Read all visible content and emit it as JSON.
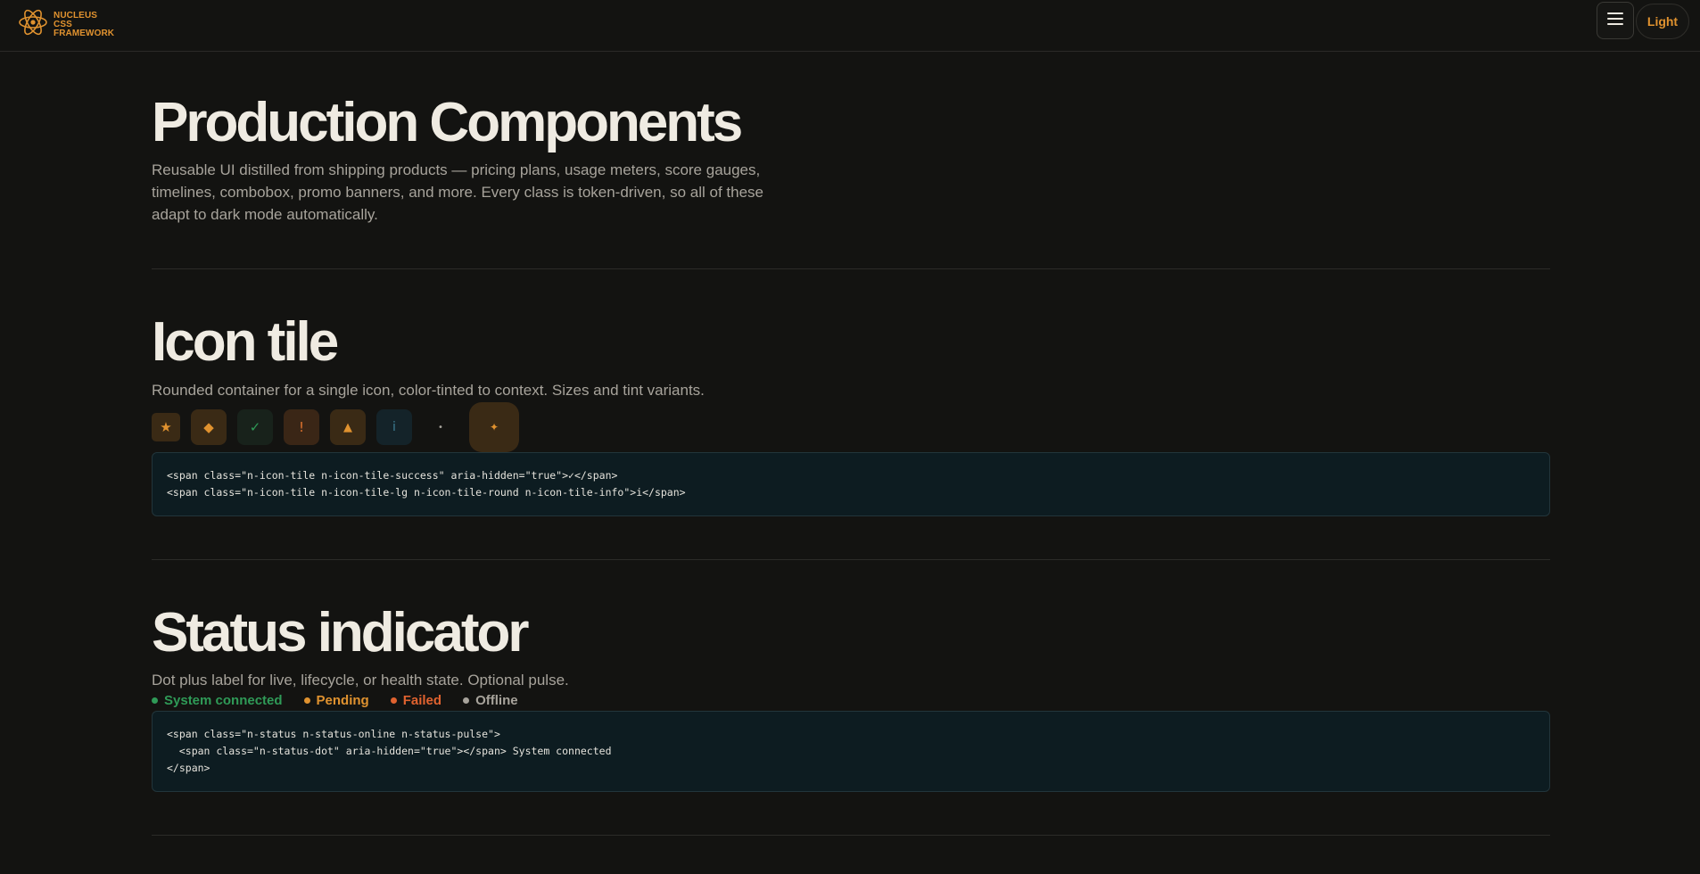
{
  "header": {
    "brand_line1": "NUCLEUS CSS",
    "brand_line2": "FRAMEWORK",
    "logo_icon": "atom-icon",
    "menu_icon": "hamburger-icon",
    "theme_toggle_label": "Light",
    "accent_color": "#e0922f"
  },
  "hero": {
    "title": "Production Components",
    "description": "Reusable UI distilled from shipping products — pricing plans, usage meters, score gauges, timelines, combobox, promo banners, and more. Every class is token-driven, so all of these adapt to dark mode automatically."
  },
  "icon_tile": {
    "title": "Icon tile",
    "description": "Rounded container for a single icon, color-tinted to context. Sizes and tint variants.",
    "tiles": [
      {
        "glyph": "★",
        "icon": "star-icon"
      },
      {
        "glyph": "◆",
        "icon": "diamond-icon"
      },
      {
        "glyph": "✓",
        "icon": "check-icon"
      },
      {
        "glyph": "!",
        "icon": "exclamation-icon"
      },
      {
        "glyph": "▲",
        "icon": "triangle-icon"
      },
      {
        "glyph": "i",
        "icon": "info-icon"
      },
      {
        "glyph": "•",
        "icon": "dot-icon"
      },
      {
        "glyph": "✦",
        "icon": "sparkle-icon"
      }
    ],
    "code": "<span class=\"n-icon-tile n-icon-tile-success\" aria-hidden=\"true\">✓</span>\n<span class=\"n-icon-tile n-icon-tile-lg n-icon-tile-round n-icon-tile-info\">i</span>"
  },
  "status_indicator": {
    "title": "Status indicator",
    "description": "Dot plus label for live, lifecycle, or health state. Optional pulse.",
    "statuses": [
      {
        "label": "System connected",
        "color": "#2f9a57"
      },
      {
        "label": "Pending",
        "color": "#e0922f"
      },
      {
        "label": "Failed",
        "color": "#e0622f"
      },
      {
        "label": "Offline",
        "color": "#a7a39b"
      }
    ],
    "code": "<span class=\"n-status n-status-online n-status-pulse\">\n  <span class=\"n-status-dot\" aria-hidden=\"true\"></span> System connected\n</span>"
  }
}
